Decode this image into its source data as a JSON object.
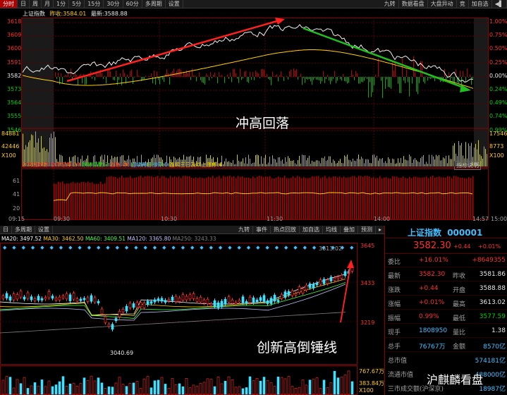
{
  "top_toolbar": {
    "tabs": [
      "分时",
      "日",
      "周",
      "月",
      "1分",
      "5分",
      "15分",
      "30分",
      "60分",
      "多周期",
      "设置"
    ],
    "right_buttons": [
      "九转",
      "数据看盘",
      "大盘异动",
      "竞",
      "加自选"
    ]
  },
  "intraday": {
    "index_name": "上证指数",
    "prev_label": "昨收:",
    "prev_value": "3584.01",
    "last_label": "最新:",
    "last_value": "3588.88",
    "left_axis": [
      "3618",
      "3609",
      "3600",
      "3591",
      "3582",
      "3573",
      "3564",
      "3555",
      "3546"
    ],
    "right_axis": [
      "1.00%",
      "0.75%",
      "0.50%",
      "0.25%",
      "0.00%",
      "0.24%",
      "0.49%",
      "0.74%",
      "0.99%"
    ],
    "vol_left": [
      "84881",
      "42446",
      "X100"
    ],
    "vol_right": [
      "17546",
      "8773",
      "X100"
    ],
    "annotation": "冲高回落",
    "breadth_caption": "沪深涨跌停",
    "limit_up_label": "涨停家数:",
    "limit_up_value": "29",
    "limit_down_label": "跌停家数:",
    "limit_down_value": "3",
    "ratio_label": "连板:",
    "ratio_value": "26",
    "two_board_label": "连续两日涨停:",
    "two_board_value": "0",
    "three_board_label": "连续三日及以上涨停:",
    "three_board_value": "4",
    "indicator_btn": "指标说明",
    "breadth_axis": [
      "61",
      "41",
      "20"
    ],
    "time_labels": [
      "09:15",
      "09:30",
      "10:30",
      "11:30",
      "14:00",
      "14:57",
      "15:00"
    ]
  },
  "kline": {
    "tabs": [
      "日",
      "多周期",
      "设置"
    ],
    "right_buttons": [
      "九转",
      "事件",
      "热点回放",
      "加自选",
      "均线",
      "叠加",
      "预测"
    ],
    "ma_legend": [
      {
        "label": "MA20: 3497.52",
        "color": "#ffffff"
      },
      {
        "label": "MA30: 3462.50",
        "color": "#ffd000"
      },
      {
        "label": "MA60: 3409.51",
        "color": "#40ff40"
      },
      {
        "label": "MA120: 3365.80",
        "color": "#c0c0ff"
      },
      {
        "label": "MA250: 3243.33",
        "color": "#808080"
      }
    ],
    "price_axis": [
      "3645",
      "3433",
      "3219"
    ],
    "high_mark": "3613.02",
    "low_mark": "3040.69",
    "annotation": "创新高倒锤线",
    "vol_axis": [
      "767.67万",
      "383.84万",
      "X100"
    ]
  },
  "quote": {
    "name": "上证指数",
    "code": "000001",
    "price": "3582.30",
    "change": "+0.44",
    "pct": "+0.01%",
    "rows": [
      {
        "l": "委比",
        "v": "+16.01%",
        "r": "",
        "rv": "+8649355"
      },
      {
        "l": "最新",
        "v": "3582.30",
        "r": "昨收",
        "rv": "3581.86"
      },
      {
        "l": "涨跌",
        "v": "+0.44",
        "r": "开盘",
        "rv": "3588.88"
      },
      {
        "l": "涨幅",
        "v": "+0.01%",
        "r": "最高",
        "rv": "3613.02"
      },
      {
        "l": "振幅",
        "v": "0.99%",
        "r": "最低",
        "rv": "3577.59"
      },
      {
        "l": "现手",
        "v": "1808950",
        "r": "量比",
        "rv": "1.38"
      },
      {
        "l": "总手",
        "v": "76767万",
        "r": "金额",
        "rv": "8570亿"
      },
      {
        "l": "总市值",
        "v": "",
        "r": "",
        "rv": "574181亿"
      },
      {
        "l": "流通市值",
        "v": "",
        "r": "",
        "rv": "488000亿"
      },
      {
        "l": "三市成交额(沪深京)",
        "v": "",
        "r": "",
        "rv": "18987亿"
      }
    ],
    "watermark": "沪麒麟看盘"
  },
  "colors": {
    "up": "#ff3030",
    "down": "#00d000",
    "accent": "#b00000",
    "bg": "#000000"
  }
}
